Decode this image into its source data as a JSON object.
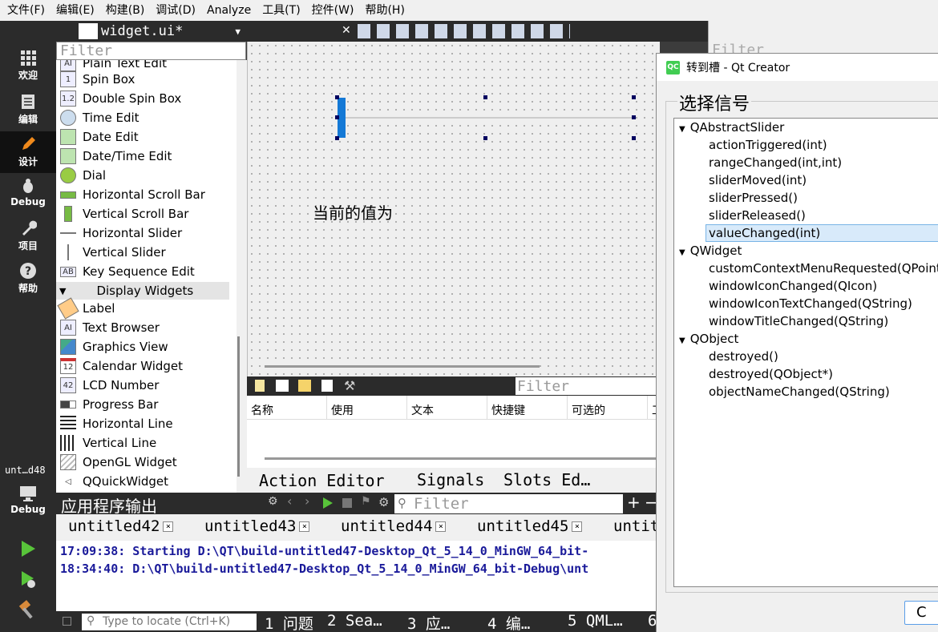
{
  "menubar": [
    "文件(F)",
    "编辑(E)",
    "构建(B)",
    "调试(D)",
    "Analyze",
    "工具(T)",
    "控件(W)",
    "帮助(H)"
  ],
  "modes": [
    "欢迎",
    "编辑",
    "设计",
    "Debug",
    "项目",
    "帮助"
  ],
  "kit": {
    "name": "unt…d48",
    "mode": "Debug"
  },
  "editor_tab": "widget.ui*",
  "widget_box": {
    "filter_placeholder": "Filter",
    "partial_item": "Plain Text Edit",
    "items_input": [
      "Spin Box",
      "Double Spin Box",
      "Time Edit",
      "Date Edit",
      "Date/Time Edit",
      "Dial",
      "Horizontal Scroll Bar",
      "Vertical Scroll Bar",
      "Horizontal Slider",
      "Vertical Slider",
      "Key Sequence Edit"
    ],
    "display_category": "Display Widgets",
    "items_display": [
      "Label",
      "Text Browser",
      "Graphics View",
      "Calendar Widget",
      "LCD Number",
      "Progress Bar",
      "Horizontal Line",
      "Vertical Line",
      "OpenGL Widget",
      "QQuickWidget"
    ]
  },
  "form": {
    "label_text": "当前的值为"
  },
  "action_editor": {
    "filter_placeholder": "Filter",
    "columns": [
      "名称",
      "使用",
      "文本",
      "快捷键",
      "可选的",
      "工"
    ],
    "tabs": [
      "Action Editor",
      "Signals",
      "Slots Ed…"
    ]
  },
  "output": {
    "title": "应用程序输出",
    "filter_placeholder": "Filter",
    "tabs": [
      "untitled42",
      "untitled43",
      "untitled44",
      "untitled45",
      "untit"
    ],
    "lines": [
      "17:09:38: Starting D:\\QT\\build-untitled47-Desktop_Qt_5_14_0_MinGW_64_bit-",
      "18:34:40: D:\\QT\\build-untitled47-Desktop_Qt_5_14_0_MinGW_64_bit-Debug\\unt"
    ]
  },
  "statusbar": {
    "locate_placeholder": "Type to locate (Ctrl+K)",
    "panes": [
      "1 问题",
      "2 Sea…",
      "3 应…",
      "4 编…",
      "5 QML…",
      "6"
    ]
  },
  "dialog": {
    "title": "转到槽 - Qt Creator",
    "icon_text": "QC",
    "group_label": "选择信号",
    "tree": [
      {
        "class": "QAbstractSlider",
        "signals": [
          "actionTriggered(int)",
          "rangeChanged(int,int)",
          "sliderMoved(int)",
          "sliderPressed()",
          "sliderReleased()",
          "valueChanged(int)"
        ]
      },
      {
        "class": "QWidget",
        "signals": [
          "customContextMenuRequested(QPoint)",
          "windowIconChanged(QIcon)",
          "windowIconTextChanged(QString)",
          "windowTitleChanged(QString)"
        ]
      },
      {
        "class": "QObject",
        "signals": [
          "destroyed()",
          "destroyed(QObject*)",
          "objectNameChanged(QString)"
        ]
      }
    ],
    "selected": "valueChanged(int)",
    "button_partial": "C"
  },
  "right_panel_filter": "Filter"
}
